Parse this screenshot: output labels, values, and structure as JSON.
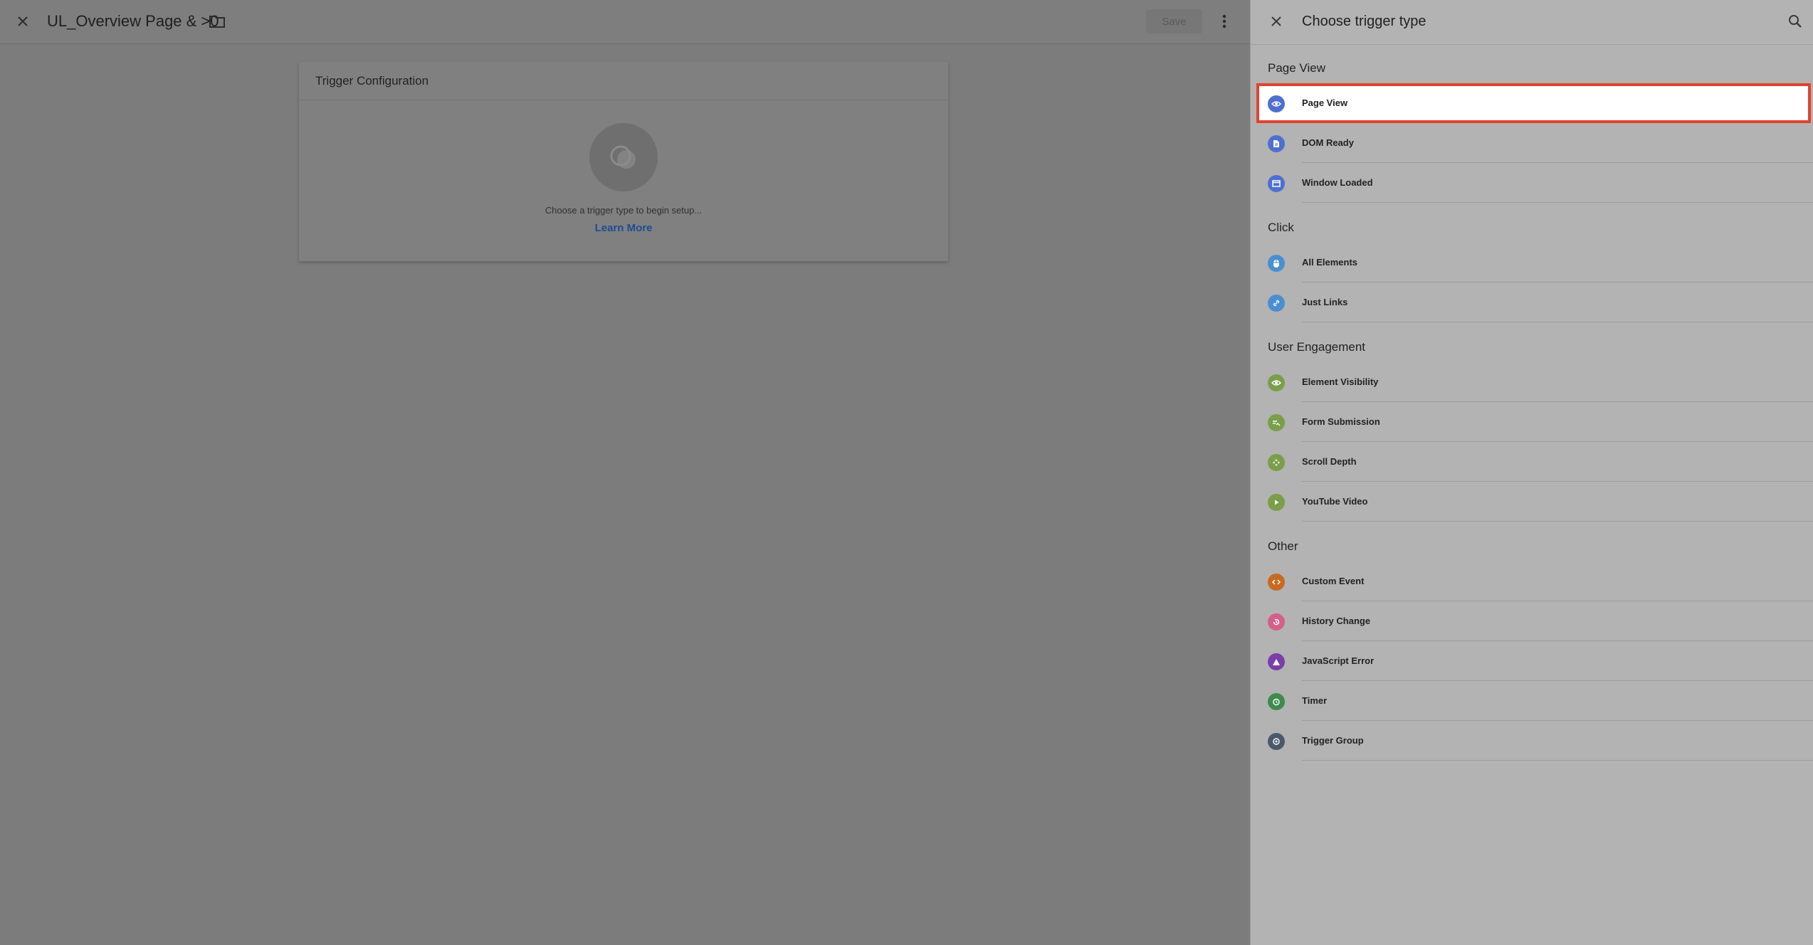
{
  "editor": {
    "title": "UL_Overview Page & >0",
    "save_label": "Save",
    "card": {
      "heading": "Trigger Configuration",
      "hint": "Choose a trigger type to begin setup...",
      "learn_more": "Learn More"
    }
  },
  "panel": {
    "title": "Choose trigger type",
    "sections": [
      {
        "title": "Page View",
        "items": [
          {
            "label": "Page View",
            "icon": "eye-icon",
            "color": "#4f6fd0"
          },
          {
            "label": "DOM Ready",
            "icon": "document-icon",
            "color": "#4f6fd0"
          },
          {
            "label": "Window Loaded",
            "icon": "window-icon",
            "color": "#4f6fd0"
          }
        ]
      },
      {
        "title": "Click",
        "items": [
          {
            "label": "All Elements",
            "icon": "mouse-icon",
            "color": "#4a8ed0"
          },
          {
            "label": "Just Links",
            "icon": "link-icon",
            "color": "#4a8ed0"
          }
        ]
      },
      {
        "title": "User Engagement",
        "items": [
          {
            "label": "Element Visibility",
            "icon": "eye-icon",
            "color": "#7a9e4a"
          },
          {
            "label": "Form Submission",
            "icon": "form-icon",
            "color": "#7a9e4a"
          },
          {
            "label": "Scroll Depth",
            "icon": "scroll-icon",
            "color": "#7a9e4a"
          },
          {
            "label": "YouTube Video",
            "icon": "play-icon",
            "color": "#7a9e4a"
          }
        ]
      },
      {
        "title": "Other",
        "items": [
          {
            "label": "Custom Event",
            "icon": "code-icon",
            "color": "#c96a22"
          },
          {
            "label": "History Change",
            "icon": "history-icon",
            "color": "#d2608a"
          },
          {
            "label": "JavaScript Error",
            "icon": "warning-icon",
            "color": "#7b3fa8"
          },
          {
            "label": "Timer",
            "icon": "timer-icon",
            "color": "#3f8a4e"
          },
          {
            "label": "Trigger Group",
            "icon": "group-icon",
            "color": "#4b5a6b"
          }
        ]
      }
    ]
  },
  "colors": {
    "selection_outline": "#e0432f",
    "link": "#1f4d92"
  }
}
